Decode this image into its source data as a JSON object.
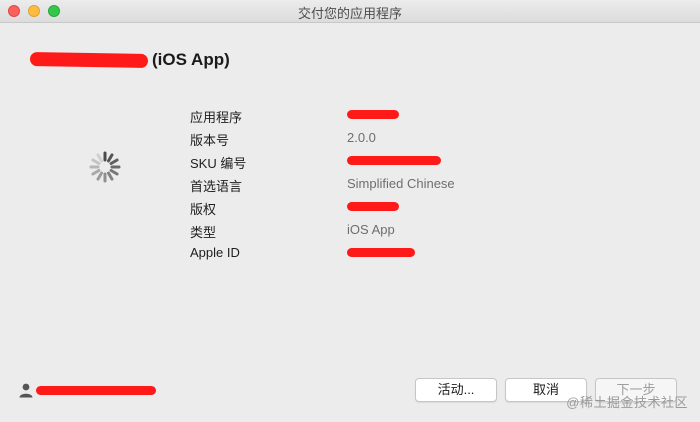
{
  "window": {
    "title": "交付您的应用程序",
    "controls": [
      "close",
      "minimize",
      "zoom"
    ]
  },
  "app": {
    "name_suffix": "(iOS App)"
  },
  "info": [
    {
      "label": "应用程序",
      "value": "",
      "redacted": true
    },
    {
      "label": "版本号",
      "value": "2.0.0",
      "redacted": false
    },
    {
      "label": "SKU 编号",
      "value": "",
      "redacted": true
    },
    {
      "label": "首选语言",
      "value": "Simplified Chinese",
      "redacted": false
    },
    {
      "label": "版权",
      "value": "",
      "redacted": true
    },
    {
      "label": "类型",
      "value": "iOS App",
      "redacted": false
    },
    {
      "label": "Apple ID",
      "value": "",
      "redacted": true
    }
  ],
  "status": {
    "icon": "spinner-icon"
  },
  "account": {
    "icon": "user-icon",
    "redacted": true
  },
  "buttons": {
    "activity": "活动...",
    "cancel": "取消",
    "next": "下一步"
  },
  "watermark": "@稀土掘金技术社区",
  "colors": {
    "redaction": "#ff1a1a",
    "window_bg": "#ececec"
  }
}
